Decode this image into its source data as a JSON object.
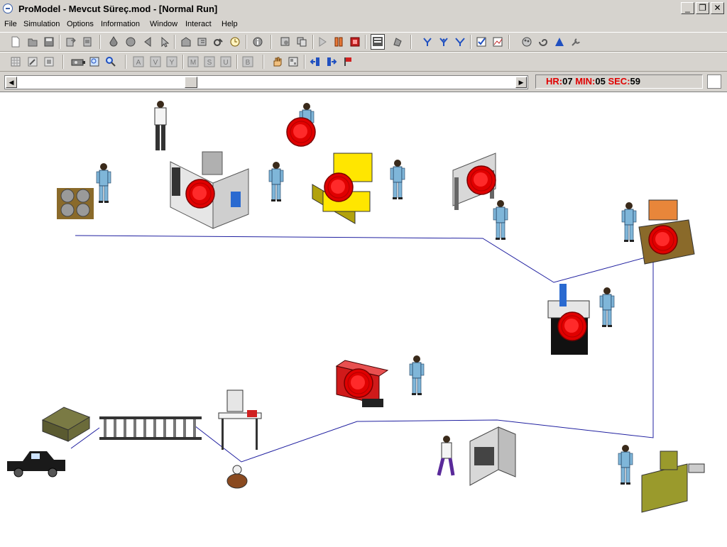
{
  "window": {
    "title": "ProModel - Mevcut Süreç.mod - [Normal Run]",
    "minimize_glyph": "_",
    "restore_glyph": "❐",
    "close_glyph": "✕"
  },
  "menu": [
    "File",
    "Simulation",
    "Options",
    "Information",
    "Window",
    "Interact",
    "Help"
  ],
  "toolbar1_icons": [
    "new-icon",
    "open-icon",
    "save-icon",
    "import-icon",
    "export-icon",
    "color-drop-icon",
    "circle-icon",
    "back-arrow-icon",
    "pointer-icon",
    "model-open-icon",
    "model-edit-icon",
    "link-icon",
    "clock-icon",
    "info-icon",
    "run-settings-icon",
    "copy-icon",
    "play-icon",
    "pause-icon",
    "stop-icon",
    "animation-on-icon",
    "animation-off-icon",
    "trace-1-icon",
    "trace-2-icon",
    "trace-3-icon",
    "checklist-icon",
    "stats-icon",
    "palette-icon",
    "spiral-icon",
    "triangle-icon",
    "wrench-icon"
  ],
  "toolbar2_icons": [
    "grid-icon",
    "edit-icon",
    "layers-icon",
    "camera-icon",
    "zoom-window-icon",
    "magnifier-icon",
    "a-icon",
    "v-icon",
    "y-icon",
    "m-icon",
    "s-icon",
    "u-icon",
    "b-icon",
    "hand-icon",
    "layout-icon",
    "back-icon",
    "forward-icon",
    "flag-icon"
  ],
  "toolbar2_letters": [
    "A",
    "V",
    "Y",
    "M",
    "S",
    "U",
    "B"
  ],
  "scrollbar": {
    "left_glyph": "◀",
    "right_glyph": "▶",
    "thumb_glyph": "⋮"
  },
  "clock": {
    "hr_label": "HR:",
    "hr_value": "07",
    "min_label": "MIN:",
    "min_value": "05",
    "sec_label": "SEC:",
    "sec_value": "59"
  },
  "colors": {
    "chrome": "#d6d3ce",
    "path": "#2020a0",
    "entity_red": "#e00000",
    "worker_blue": "#7fb6d9",
    "machine_yellow": "#ffe600",
    "truck": "#1a1a1a",
    "pallet_green": "#6b6b3a",
    "cnc_olive": "#9a9a2c"
  }
}
